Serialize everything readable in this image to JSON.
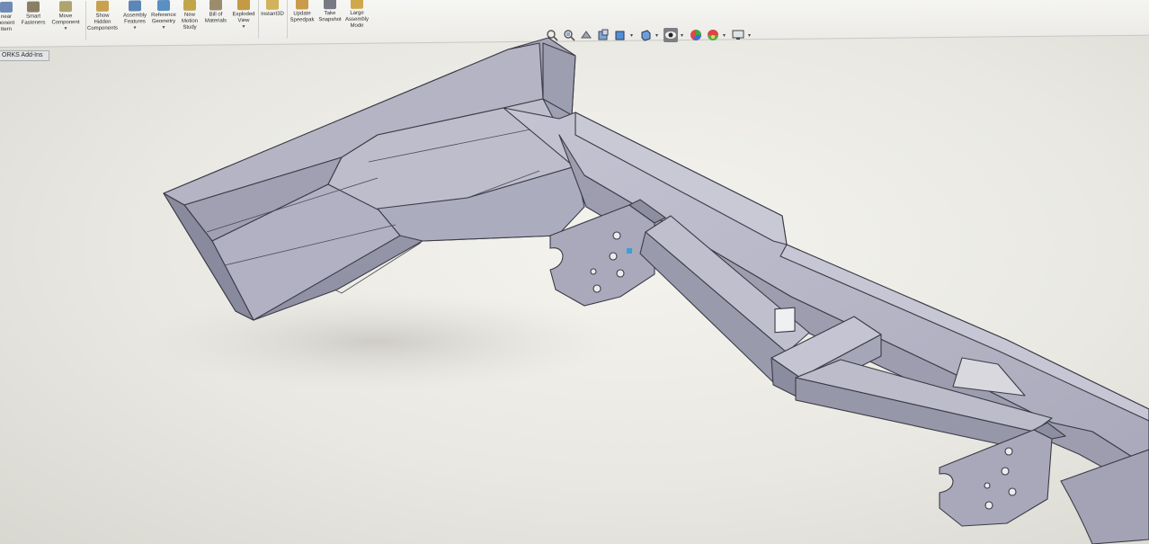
{
  "ribbon": {
    "buttons": [
      {
        "label": "Linear\nComponent\nPattern",
        "icon": "linear-pattern-icon"
      },
      {
        "label": "Smart\nFasteners",
        "icon": "smart-fasteners-icon"
      },
      {
        "label": "Move\nComponent",
        "icon": "move-component-icon"
      },
      {
        "label": "Show\nHidden\nComponents",
        "icon": "show-hidden-icon"
      },
      {
        "label": "Assembly\nFeatures",
        "icon": "assembly-features-icon"
      },
      {
        "label": "Reference\nGeometry",
        "icon": "reference-geometry-icon"
      },
      {
        "label": "New\nMotion\nStudy",
        "icon": "motion-study-icon"
      },
      {
        "label": "Bill of\nMaterials",
        "icon": "bom-icon"
      },
      {
        "label": "Exploded\nView",
        "icon": "exploded-view-icon"
      },
      {
        "label": "Instant3D",
        "icon": "instant3d-icon"
      },
      {
        "label": "Update\nSpeedpak",
        "icon": "speedpak-icon"
      },
      {
        "label": "Take\nSnapshot",
        "icon": "snapshot-icon"
      },
      {
        "label": "Large\nAssembly\nMode",
        "icon": "large-assembly-icon"
      }
    ],
    "visible_labels": {
      "b0": "near\nponent\nttern",
      "b1": "Smart\nFasteners",
      "b2": "Move\nComponent",
      "b3": "Show\nHidden\nComponents",
      "b4": "Assembly\nFeatures",
      "b5": "Reference\nGeometry",
      "b6": "New\nMotion\nStudy",
      "b7": "Bill of\nMaterials",
      "b8": "Exploded\nView",
      "b9": "Instant3D",
      "b10": "Update\nSpeedpak",
      "b11": "Take\nSnapshot",
      "b12": "Large\nAssembly\nMode"
    }
  },
  "tab": {
    "label": "ORKS Add-Ins"
  },
  "heads_up_toolbar": [
    "zoom-to-fit-icon",
    "zoom-to-area-icon",
    "previous-view-icon",
    "section-view-icon",
    "view-orientation-icon",
    "display-style-icon",
    "hide-show-items-icon",
    "edit-appearance-icon",
    "apply-scene-icon",
    "view-settings-icon"
  ],
  "colors": {
    "model_face_light": "#b9b9c9",
    "model_face_mid": "#a3a3b4",
    "model_face_dark": "#8e8ea1",
    "edge": "#3b3b46",
    "background": "#ecebe5"
  }
}
